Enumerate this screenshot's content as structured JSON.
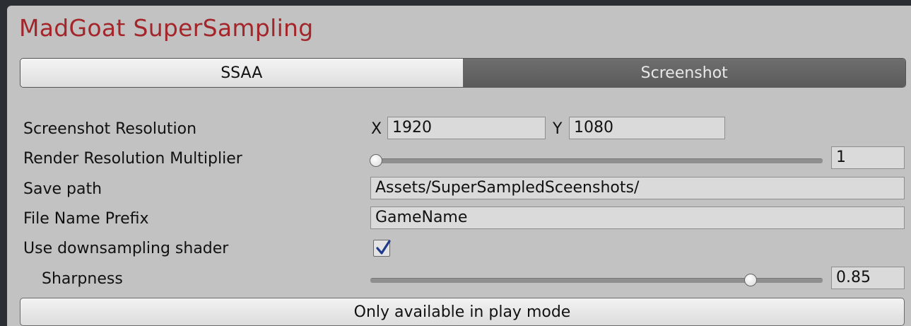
{
  "header": {
    "title": "MadGoat SuperSampling"
  },
  "tabs": [
    {
      "label": "SSAA",
      "active": true
    },
    {
      "label": "Screenshot",
      "active": false
    }
  ],
  "fields": {
    "screenshot_resolution": {
      "label": "Screenshot Resolution",
      "x_label": "X",
      "x_value": "1920",
      "y_label": "Y",
      "y_value": "1080"
    },
    "render_multiplier": {
      "label": "Render Resolution Multiplier",
      "value": "1",
      "slider_min": 1,
      "slider_max": 4,
      "slider_value": 1
    },
    "save_path": {
      "label": "Save path",
      "value": "Assets/SuperSampledSceenshots/"
    },
    "file_prefix": {
      "label": "File Name Prefix",
      "value": "GameName"
    },
    "downsampling": {
      "label": "Use downsampling shader",
      "checked": true
    },
    "sharpness": {
      "label": "Sharpness",
      "value": "0.85",
      "slider_min": 0,
      "slider_max": 1,
      "slider_value": 0.85
    }
  },
  "footer": {
    "button_label": "Only available in play mode"
  },
  "colors": {
    "title": "#a3262a",
    "panel": "#c2c2c2",
    "check": "#1e3a8a"
  }
}
